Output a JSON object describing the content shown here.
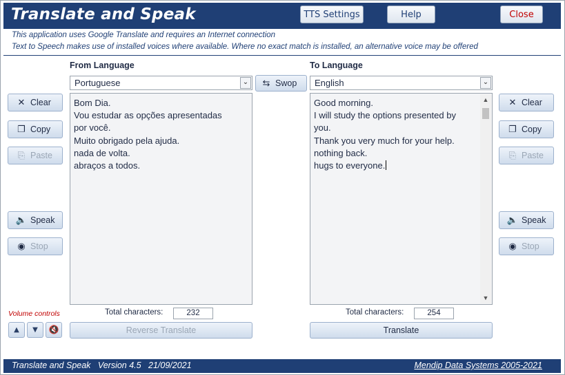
{
  "window": {
    "title": "Translate and Speak",
    "buttons": {
      "tts_settings": "TTS Settings",
      "help": "Help",
      "close": "Close"
    }
  },
  "info": {
    "line1": "This application uses Google Translate and requires an Internet connection",
    "line2": "Text to Speech makes use of installed voices where available. Where no exact match is installed, an alternative voice may be offered"
  },
  "from": {
    "label": "From Language",
    "language": "Portuguese",
    "lines": [
      "Bom Dia.",
      "Vou estudar as opções apresentadas",
      "por você.",
      "Muito obrigado pela ajuda.",
      "nada de volta.",
      "abraços a todos."
    ],
    "count_label": "Total characters:",
    "count": "232"
  },
  "to": {
    "label": "To Language",
    "language": "English",
    "lines": [
      "Good morning.",
      "I will study the options presented by",
      "you.",
      "Thank you very much for your help.",
      "nothing back.",
      "hugs to everyone."
    ],
    "count_label": "Total characters:",
    "count": "254"
  },
  "swop_label": "Swop",
  "side_buttons": {
    "clear": "Clear",
    "copy": "Copy",
    "paste": "Paste",
    "speak": "Speak",
    "stop": "Stop"
  },
  "reverse_translate": "Reverse Translate",
  "translate": "Translate",
  "volume_label": "Volume controls",
  "footer": {
    "left": "Translate and Speak   Version 4.5   21/09/2021",
    "right": "Mendip Data Systems 2005-2021"
  },
  "colors": {
    "brand": "#1f3f75",
    "close_text": "#c00000",
    "volume_label": "#c00000"
  },
  "icons": [
    "clear-x-icon",
    "copy-icon",
    "paste-icon",
    "speaker-icon",
    "stop-icon",
    "swap-arrows-icon",
    "volume-up-icon",
    "volume-down-icon",
    "mute-icon",
    "chevron-down-icon"
  ]
}
